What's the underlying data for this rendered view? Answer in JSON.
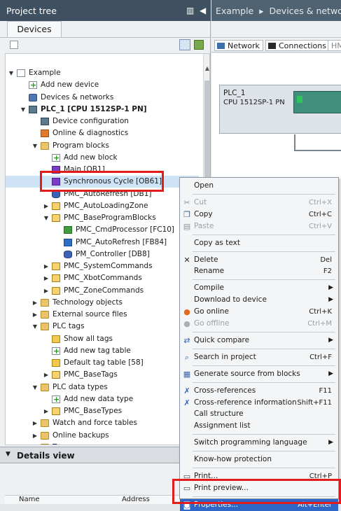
{
  "pane": {
    "title": "Project tree",
    "tab": "Devices"
  },
  "tree": [
    {
      "id": "example",
      "label": "Example",
      "level": 0,
      "twisty": "open",
      "icon": "doc"
    },
    {
      "id": "add-device",
      "label": "Add new device",
      "level": 1,
      "twisty": "none",
      "icon": "add"
    },
    {
      "id": "devices-networks",
      "label": "Devices & networks",
      "level": 1,
      "twisty": "none",
      "icon": "net"
    },
    {
      "id": "plc1",
      "label": "PLC_1 [CPU 1512SP-1 PN]",
      "level": 1,
      "twisty": "open",
      "icon": "plc",
      "bold": true
    },
    {
      "id": "device-config",
      "label": "Device configuration",
      "level": 2,
      "twisty": "none",
      "icon": "plc"
    },
    {
      "id": "online-diag",
      "label": "Online & diagnostics",
      "level": 2,
      "twisty": "none",
      "icon": "diag"
    },
    {
      "id": "program-blocks",
      "label": "Program blocks",
      "level": 2,
      "twisty": "open",
      "icon": "folder"
    },
    {
      "id": "add-block",
      "label": "Add new block",
      "level": 3,
      "twisty": "none",
      "icon": "add"
    },
    {
      "id": "main",
      "label": "Main [OB1]",
      "level": 3,
      "twisty": "none",
      "icon": "ob"
    },
    {
      "id": "sync-cycle",
      "label": "Synchronous Cycle [OB61]",
      "level": 3,
      "twisty": "none",
      "icon": "ob",
      "selected": true
    },
    {
      "id": "pmc-autorefresh-db",
      "label": "PMC_AutoRefresh [DB1]",
      "level": 3,
      "twisty": "none",
      "icon": "db"
    },
    {
      "id": "pmc-autoloading",
      "label": "PMC_AutoLoadingZone",
      "level": 3,
      "twisty": "closed",
      "icon": "blocks"
    },
    {
      "id": "pmc-baseprog",
      "label": "PMC_BaseProgramBlocks",
      "level": 3,
      "twisty": "open",
      "icon": "blocks"
    },
    {
      "id": "pmc-cmdproc",
      "label": "PMC_CmdProcessor [FC10]",
      "level": 4,
      "twisty": "none",
      "icon": "fc"
    },
    {
      "id": "pmc-autorefresh-fb",
      "label": "PMC_AutoRefresh [FB84]",
      "level": 4,
      "twisty": "none",
      "icon": "fb"
    },
    {
      "id": "pm-controller",
      "label": "PM_Controller [DB8]",
      "level": 4,
      "twisty": "none",
      "icon": "db"
    },
    {
      "id": "pmc-syscmd",
      "label": "PMC_SystemCommands",
      "level": 3,
      "twisty": "closed",
      "icon": "blocks"
    },
    {
      "id": "pmc-xbot",
      "label": "PMC_XbotCommands",
      "level": 3,
      "twisty": "closed",
      "icon": "blocks"
    },
    {
      "id": "pmc-zone",
      "label": "PMC_ZoneCommands",
      "level": 3,
      "twisty": "closed",
      "icon": "blocks"
    },
    {
      "id": "tech-objects",
      "label": "Technology objects",
      "level": 2,
      "twisty": "closed",
      "icon": "folder"
    },
    {
      "id": "ext-source",
      "label": "External source files",
      "level": 2,
      "twisty": "closed",
      "icon": "folder"
    },
    {
      "id": "plc-tags",
      "label": "PLC tags",
      "level": 2,
      "twisty": "open",
      "icon": "folder"
    },
    {
      "id": "show-all-tags",
      "label": "Show all tags",
      "level": 3,
      "twisty": "none",
      "icon": "tag"
    },
    {
      "id": "add-tag-table",
      "label": "Add new tag table",
      "level": 3,
      "twisty": "none",
      "icon": "add"
    },
    {
      "id": "default-tag-table",
      "label": "Default tag table [58]",
      "level": 3,
      "twisty": "none",
      "icon": "tag"
    },
    {
      "id": "pmc-basetags",
      "label": "PMC_BaseTags",
      "level": 3,
      "twisty": "closed",
      "icon": "blocks"
    },
    {
      "id": "plc-data-types",
      "label": "PLC data types",
      "level": 2,
      "twisty": "open",
      "icon": "folder"
    },
    {
      "id": "add-data-type",
      "label": "Add new data type",
      "level": 3,
      "twisty": "none",
      "icon": "add"
    },
    {
      "id": "pmc-basetypes",
      "label": "PMC_BaseTypes",
      "level": 3,
      "twisty": "closed",
      "icon": "blocks"
    },
    {
      "id": "watch-force",
      "label": "Watch and force tables",
      "level": 2,
      "twisty": "closed",
      "icon": "folder"
    },
    {
      "id": "online-backups",
      "label": "Online backups",
      "level": 2,
      "twisty": "closed",
      "icon": "folder"
    },
    {
      "id": "traces",
      "label": "Traces",
      "level": 2,
      "twisty": "closed",
      "icon": "folder"
    }
  ],
  "details": {
    "title": "Details view",
    "col_name": "Name",
    "col_address": "Address"
  },
  "right": {
    "crumb_project": "Example",
    "crumb_sep": "▸",
    "crumb_next": "Devices & network",
    "tab_network": "Network",
    "tab_connections": "Connections",
    "tab_hmi": "HM",
    "plc_name": "PLC_1",
    "plc_type": "CPU 1512SP-1 PN"
  },
  "menu": [
    {
      "id": "open",
      "label": "Open",
      "shortcut": "",
      "icon": "",
      "disabled": false
    },
    {
      "sep": true
    },
    {
      "id": "cut",
      "label": "Cut",
      "shortcut": "Ctrl+X",
      "icon": "scissors",
      "disabled": true
    },
    {
      "id": "copy",
      "label": "Copy",
      "shortcut": "Ctrl+C",
      "icon": "copy",
      "disabled": false
    },
    {
      "id": "paste",
      "label": "Paste",
      "shortcut": "Ctrl+V",
      "icon": "paste",
      "disabled": true
    },
    {
      "sep": true
    },
    {
      "id": "copy-as-text",
      "label": "Copy as text",
      "shortcut": "",
      "icon": "",
      "disabled": false
    },
    {
      "sep": true
    },
    {
      "id": "delete",
      "label": "Delete",
      "shortcut": "Del",
      "icon": "delete",
      "disabled": false
    },
    {
      "id": "rename",
      "label": "Rename",
      "shortcut": "F2",
      "icon": "",
      "disabled": false
    },
    {
      "sep": true
    },
    {
      "id": "compile",
      "label": "Compile",
      "shortcut": "",
      "icon": "",
      "disabled": false,
      "submenu": true
    },
    {
      "id": "download",
      "label": "Download to device",
      "shortcut": "",
      "icon": "",
      "disabled": false,
      "submenu": true
    },
    {
      "id": "go-online",
      "label": "Go online",
      "shortcut": "Ctrl+K",
      "icon": "online",
      "disabled": false
    },
    {
      "id": "go-offline",
      "label": "Go offline",
      "shortcut": "Ctrl+M",
      "icon": "offline",
      "disabled": true
    },
    {
      "sep": true
    },
    {
      "id": "quick-compare",
      "label": "Quick compare",
      "shortcut": "",
      "icon": "compare",
      "disabled": false,
      "submenu": true
    },
    {
      "sep": true
    },
    {
      "id": "search-project",
      "label": "Search in project",
      "shortcut": "Ctrl+F",
      "icon": "search",
      "disabled": false
    },
    {
      "sep": true
    },
    {
      "id": "gen-source",
      "label": "Generate source from blocks",
      "shortcut": "",
      "icon": "source",
      "disabled": false,
      "submenu": true
    },
    {
      "sep": true
    },
    {
      "id": "cross-ref",
      "label": "Cross-references",
      "shortcut": "F11",
      "icon": "xref",
      "disabled": false
    },
    {
      "id": "cross-ref-info",
      "label": "Cross-reference information",
      "shortcut": "Shift+F11",
      "icon": "xref",
      "disabled": false
    },
    {
      "id": "call-structure",
      "label": "Call structure",
      "shortcut": "",
      "icon": "",
      "disabled": false
    },
    {
      "id": "assignment-list",
      "label": "Assignment list",
      "shortcut": "",
      "icon": "",
      "disabled": false
    },
    {
      "sep": true
    },
    {
      "id": "switch-lang",
      "label": "Switch programming language",
      "shortcut": "",
      "icon": "",
      "disabled": false,
      "submenu": true
    },
    {
      "sep": true
    },
    {
      "id": "knowhow",
      "label": "Know-how protection",
      "shortcut": "",
      "icon": "",
      "disabled": false
    },
    {
      "sep": true
    },
    {
      "id": "print",
      "label": "Print...",
      "shortcut": "Ctrl+P",
      "icon": "print",
      "disabled": false
    },
    {
      "id": "print-preview",
      "label": "Print preview...",
      "shortcut": "",
      "icon": "preview",
      "disabled": false
    },
    {
      "sep": true
    },
    {
      "id": "properties",
      "label": "Properties...",
      "shortcut": "Alt+Enter",
      "icon": "properties",
      "disabled": false,
      "highlighted": true
    }
  ],
  "colors": {
    "header": "#3f5160",
    "highlight_box": "#e21b1b",
    "menu_highlight": "#2f67c9"
  }
}
